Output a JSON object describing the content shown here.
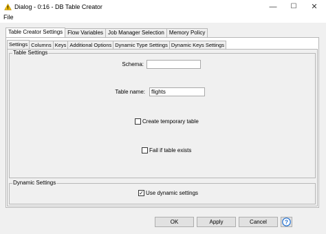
{
  "window": {
    "title": "Dialog - 0:16 - DB Table Creator",
    "icon": "warning-triangle-icon",
    "minimize": "—",
    "maximize": "☐",
    "close": "✕"
  },
  "menu": {
    "file": "File"
  },
  "outer_tabs": [
    "Table Creator Settings",
    "Flow Variables",
    "Job Manager Selection",
    "Memory Policy"
  ],
  "inner_tabs": [
    "Settings",
    "Columns",
    "Keys",
    "Additional Options",
    "Dynamic Type Settings",
    "Dynamic Keys Settings"
  ],
  "table_settings": {
    "group_label": "Table Settings",
    "schema_label": "Schema:",
    "schema_value": "",
    "table_name_label": "Table name:",
    "table_name_value": "flights",
    "temp_table_label": "Create temporary table",
    "temp_table_checked": false,
    "fail_exists_label": "Fail if table exists",
    "fail_exists_checked": false
  },
  "dynamic_settings": {
    "group_label": "Dynamic Settings",
    "use_dynamic_label": "Use dynamic settings",
    "use_dynamic_checked": true,
    "checkmark": "✓"
  },
  "buttons": {
    "ok": "OK",
    "apply": "Apply",
    "cancel": "Cancel",
    "help": "?"
  },
  "colors": {
    "warning": "#e8b500",
    "help_accent": "#1f6fd1"
  }
}
